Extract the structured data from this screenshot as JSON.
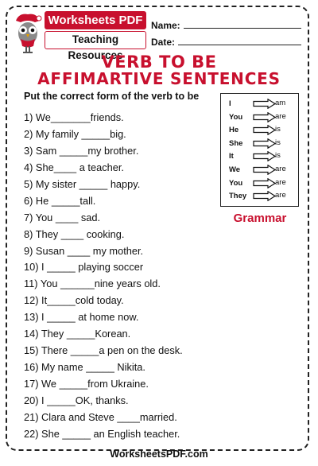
{
  "brand": {
    "name": "Worksheets PDF",
    "subtitle": "Teaching Resources",
    "color": "#c8102e"
  },
  "header_fields": {
    "name_label": "Name:",
    "date_label": "Date:"
  },
  "title": {
    "line1": "VERB TO BE",
    "line2": "AFFIMARTIVE SENTENCES"
  },
  "instruction": "Put the correct form of the verb to be",
  "items": [
    "1) We_______friends.",
    "2) My family _____big.",
    "3) Sam _____my brother.",
    "4) She____ a teacher.",
    "5)  My sister _____ happy.",
    "6) He _____tall.",
    "7) You ____ sad.",
    "8) They ____ cooking.",
    "9) Susan ____ my mother.",
    "10) I _____ playing soccer",
    "11) You ______nine years old.",
    "12) It_____cold today.",
    "13) I _____ at home now.",
    "14) They _____Korean.",
    "15) There _____a pen on the desk.",
    "16) My name _____ Nikita.",
    "17) We _____from Ukraine.",
    "20) I _____OK, thanks.",
    "21) Clara and Steve ____married.",
    "22) She _____ an English teacher."
  ],
  "pronoun_table": [
    {
      "pronoun": "I",
      "verb": "am"
    },
    {
      "pronoun": "You",
      "verb": "are"
    },
    {
      "pronoun": "He",
      "verb": "is"
    },
    {
      "pronoun": "She",
      "verb": "is"
    },
    {
      "pronoun": "It",
      "verb": "is"
    },
    {
      "pronoun": "We",
      "verb": "are"
    },
    {
      "pronoun": "You",
      "verb": "are"
    },
    {
      "pronoun": "They",
      "verb": "are"
    }
  ],
  "grammar_label": "Grammar",
  "footer": "WorksheetsPDF.com"
}
